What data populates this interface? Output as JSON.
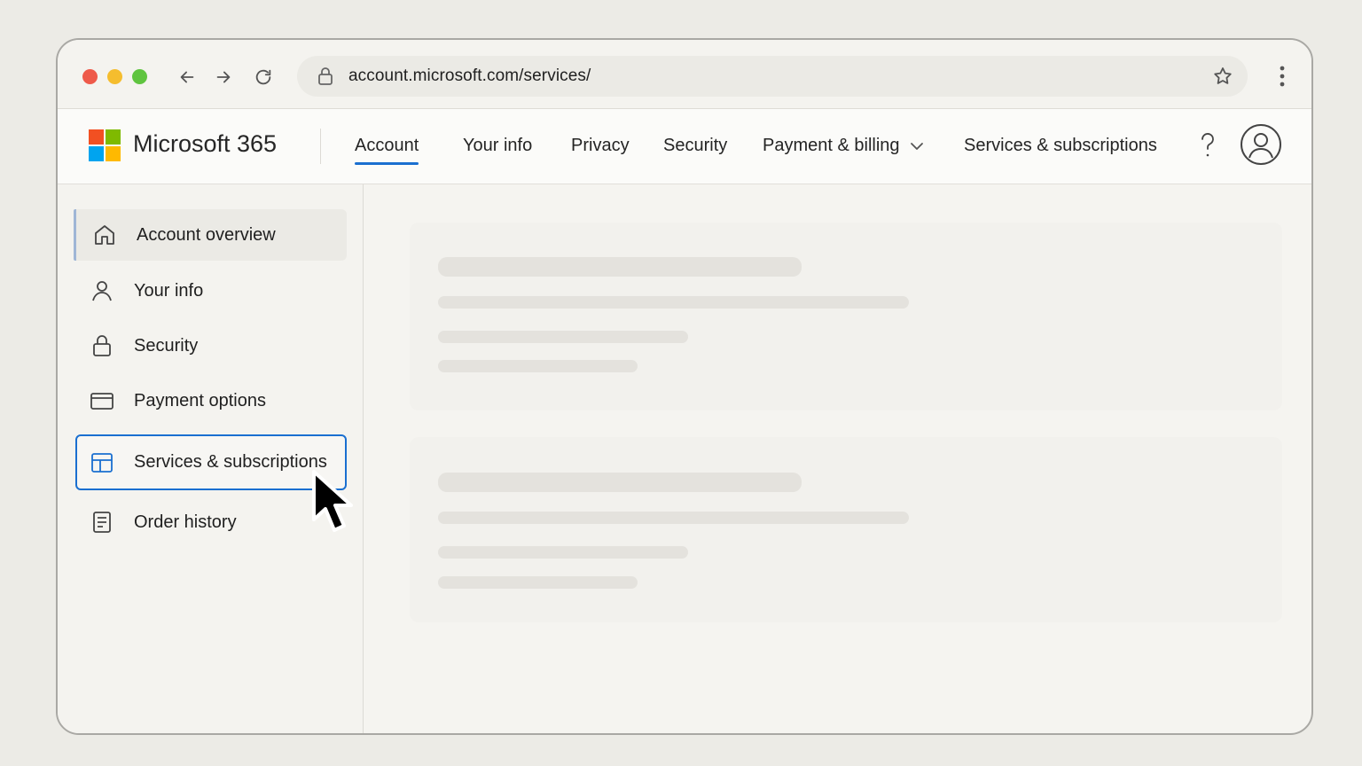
{
  "browser": {
    "url": "account.microsoft.com/services/"
  },
  "header": {
    "brand": "Microsoft 365",
    "nav": [
      {
        "label": "Account"
      },
      {
        "label": "Your info"
      },
      {
        "label": "Privacy"
      },
      {
        "label": "Security"
      },
      {
        "label": "Payment & billing"
      },
      {
        "label": "Services & subscriptions"
      }
    ],
    "active_nav": "Account"
  },
  "sidebar": {
    "items": [
      {
        "label": "Account overview",
        "icon": "home-icon"
      },
      {
        "label": "Your info",
        "icon": "person-icon"
      },
      {
        "label": "Security",
        "icon": "lock-icon"
      },
      {
        "label": "Payment options",
        "icon": "credit-card-icon"
      },
      {
        "label": "Services & subscriptions",
        "icon": "grid-icon"
      },
      {
        "label": "Order history",
        "icon": "receipt-icon"
      }
    ],
    "current": "Account overview",
    "focused": "Services & subscriptions"
  },
  "colors": {
    "accent": "#1a6fd0",
    "logo_red": "#f25022",
    "logo_green": "#7fba00",
    "logo_blue": "#00a4ef",
    "logo_yellow": "#ffb900"
  }
}
